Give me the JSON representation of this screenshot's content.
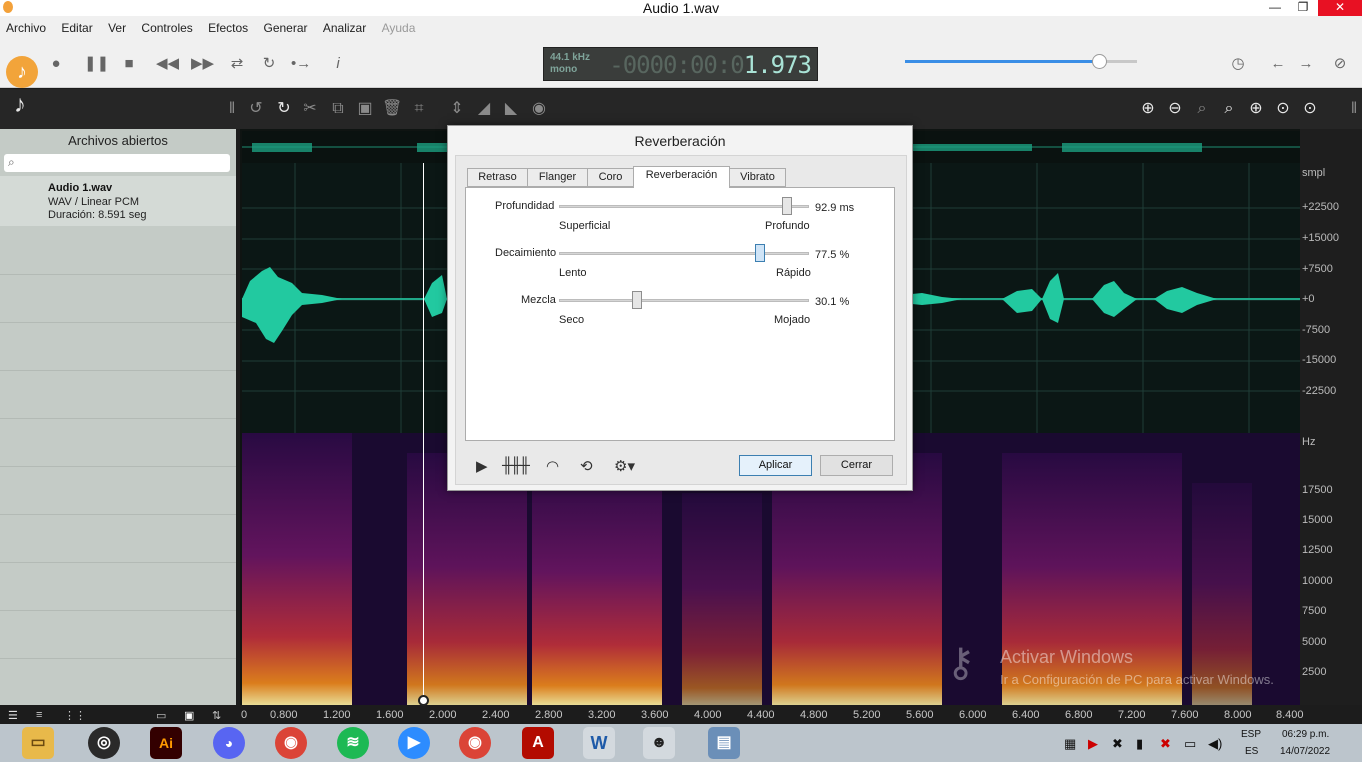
{
  "window": {
    "title": "Audio 1.wav",
    "minimize": "—",
    "maximize": "❐",
    "close": "✕"
  },
  "menu": [
    "Archivo",
    "Editar",
    "Ver",
    "Controles",
    "Efectos",
    "Generar",
    "Analizar",
    "Ayuda"
  ],
  "lcd": {
    "rate": "44.1 kHz",
    "channels": "mono",
    "dim_digits": "-0000:00:0",
    "time": "1.973"
  },
  "volume": {
    "level_fraction": 0.84
  },
  "sidebar": {
    "title": "Archivos abiertos",
    "search_placeholder": "",
    "file": {
      "name": "Audio 1.wav",
      "format": "WAV / Linear PCM",
      "duration": "Duración: 8.591 seg"
    }
  },
  "amp_ruler": [
    "smpl",
    "+22500",
    "+15000",
    "+7500",
    "+0",
    "-7500",
    "-15000",
    "-22500"
  ],
  "freq_ruler": [
    "Hz",
    "17500",
    "15000",
    "12500",
    "10000",
    "7500",
    "5000",
    "2500"
  ],
  "timeline": [
    "0",
    "0.800",
    "1.200",
    "1.600",
    "2.000",
    "2.400",
    "2.800",
    "3.200",
    "3.600",
    "4.000",
    "4.400",
    "4.800",
    "5.200",
    "5.600",
    "6.000",
    "6.400",
    "6.800",
    "7.200",
    "7.600",
    "8.000",
    "8.400"
  ],
  "dialog": {
    "title": "Reverberación",
    "tabs": [
      "Retraso",
      "Flanger",
      "Coro",
      "Reverberación",
      "Vibrato"
    ],
    "active_tab": 3,
    "params": [
      {
        "label": "Profundidad",
        "value": "92.9 ms",
        "min": "Superficial",
        "max": "Profundo",
        "fraction": 0.92
      },
      {
        "label": "Decaimiento",
        "value": "77.5 %",
        "min": "Lento",
        "max": "Rápido",
        "fraction": 0.775
      },
      {
        "label": "Mezcla",
        "value": "30.1 %",
        "min": "Seco",
        "max": "Mojado",
        "fraction": 0.301
      }
    ],
    "apply": "Aplicar",
    "close": "Cerrar"
  },
  "watermark": {
    "line1": "Activar Windows",
    "line2": "Ir a Configuración de PC para activar Windows."
  },
  "taskbar": {
    "apps": [
      "Explorador",
      "OBS",
      "Illustrator",
      "Discord",
      "Chrome",
      "Spotify",
      "Zoom",
      "Chrome 2",
      "Acrobat",
      "Word",
      "Ocenaudio",
      "Fotos"
    ],
    "lang_top": "ESP",
    "lang_bottom": "ES",
    "time": "06:29 p.m.",
    "date": "14/07/2022"
  }
}
